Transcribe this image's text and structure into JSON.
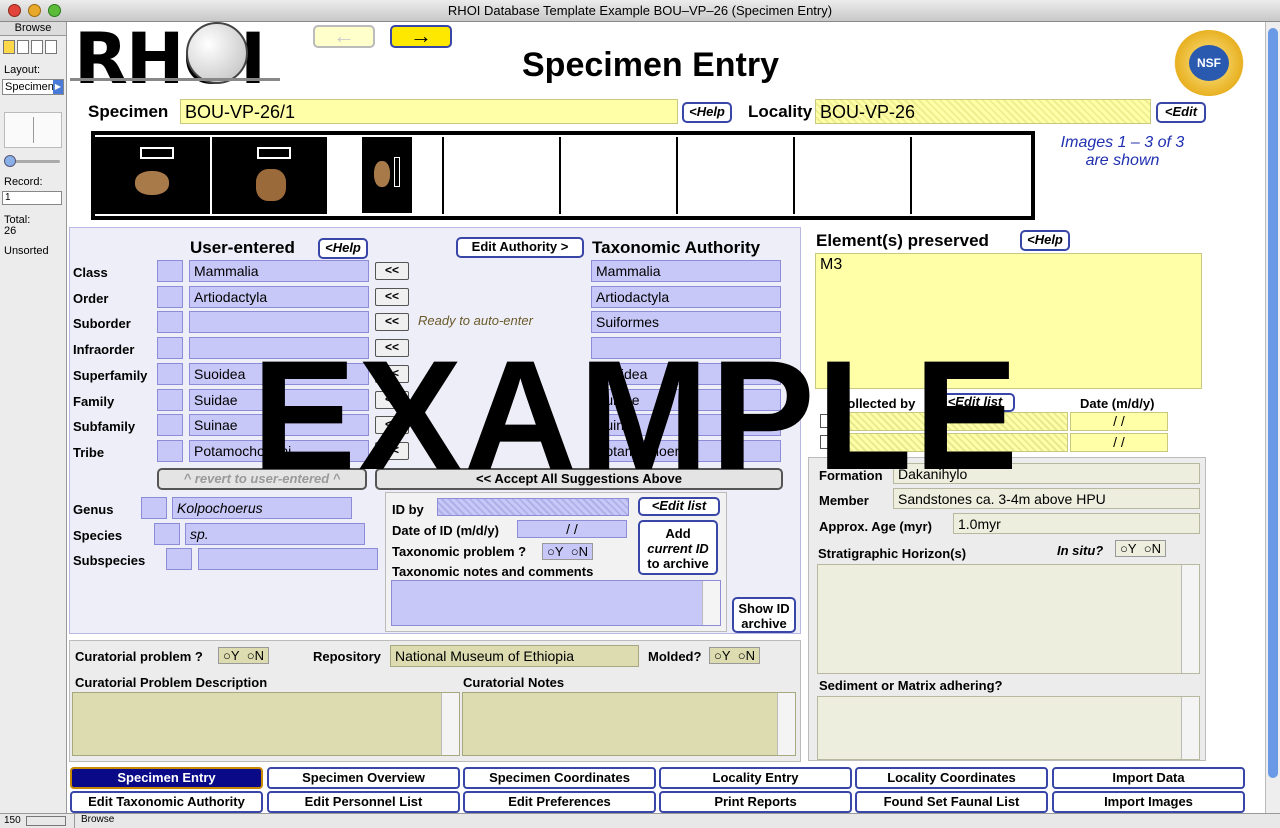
{
  "window": {
    "title": "RHOI Database Template Example BOU–VP–26 (Specimen Entry)"
  },
  "sidebar": {
    "mode": "Browse",
    "layout_label": "Layout:",
    "layout_value": "Specimen",
    "record_label": "Record:",
    "record_value": "1",
    "total_label": "Total:",
    "total_value": "26",
    "sort_status": "Unsorted"
  },
  "status": {
    "zoom": "150",
    "mode": "Browse"
  },
  "header": {
    "logo": "RHOI",
    "page_title": "Specimen Entry",
    "nsf": "NSF",
    "nav_prev": "←",
    "nav_next": "→"
  },
  "specimen": {
    "label": "Specimen",
    "value": "BOU-VP-26/1",
    "help": "<Help"
  },
  "locality": {
    "label": "Locality",
    "value": "BOU-VP-26",
    "edit": "<Edit"
  },
  "images": {
    "line1": "Images 1 – 3 of 3",
    "line2": "are shown"
  },
  "taxonomy": {
    "user_header": "User-entered",
    "help": "<Help",
    "edit_authority": "Edit Authority >",
    "authority_header": "Taxonomic Authority",
    "ranks": [
      {
        "label": "Class",
        "user": "Mammalia",
        "auth": "Mammalia"
      },
      {
        "label": "Order",
        "user": "Artiodactyla",
        "auth": "Artiodactyla"
      },
      {
        "label": "Suborder",
        "user": "",
        "auth": "Suiformes"
      },
      {
        "label": "Infraorder",
        "user": "",
        "auth": ""
      },
      {
        "label": "Superfamily",
        "user": "Suoidea",
        "auth": "Suoidea"
      },
      {
        "label": "Family",
        "user": "Suidae",
        "auth": "Suidae"
      },
      {
        "label": "Subfamily",
        "user": "Suinae",
        "auth": "Suinae"
      },
      {
        "label": "Tribe",
        "user": "Potamochoerini",
        "auth": "Potamochoerini"
      }
    ],
    "copy_btn": "<<",
    "auto_note": "Ready to auto-enter",
    "revert": "^ revert to user-entered ^",
    "accept_all": "<< Accept All Suggestions Above",
    "genus_label": "Genus",
    "genus": "Kolpochoerus",
    "species_label": "Species",
    "species": "sp.",
    "subspecies_label": "Subspecies",
    "subspecies": ""
  },
  "id": {
    "by_label": "ID by",
    "edit_list": "<Edit list",
    "date_label": "Date of ID (m/d/y)",
    "date_value": "/     /",
    "problem_label": "Taxonomic problem ?",
    "notes_label": "Taxonomic notes and comments",
    "add_line1": "Add",
    "add_line2": "current ID",
    "add_line3": "to archive",
    "show_line1": "Show ID",
    "show_line2": "archive",
    "yes": "Y",
    "no": "N"
  },
  "elements": {
    "label": "Element(s) preserved",
    "help": "<Help",
    "value": "M3",
    "collected_label": "Collected by",
    "edit_list": "<Edit list",
    "date_label": "Date (m/d/y)",
    "date_value": "/     /"
  },
  "geology": {
    "formation_label": "Formation",
    "formation": "Dakanihylo",
    "member_label": "Member",
    "member": "Sandstones ca. 3-4m above HPU",
    "age_label": "Approx. Age (myr)",
    "age": "1.0myr",
    "horizon_label": "Stratigraphic Horizon(s)",
    "insitu_label": "In situ?",
    "sediment_label": "Sediment or Matrix adhering?"
  },
  "curation": {
    "problem_label": "Curatorial problem ?",
    "repository_label": "Repository",
    "repository": "National Museum of Ethiopia",
    "molded_label": "Molded?",
    "desc_label": "Curatorial Problem Description",
    "notes_label": "Curatorial Notes"
  },
  "watermark": "EXAMPLE",
  "tabs_row1": [
    "Specimen Entry",
    "Specimen Overview",
    "Specimen Coordinates",
    "Locality Entry",
    "Locality Coordinates",
    "Import Data"
  ],
  "tabs_row2": [
    "Edit Taxonomic Authority",
    "Edit Personnel List",
    "Edit Preferences",
    "Print Reports",
    "Found Set Faunal List",
    "Import Images"
  ]
}
